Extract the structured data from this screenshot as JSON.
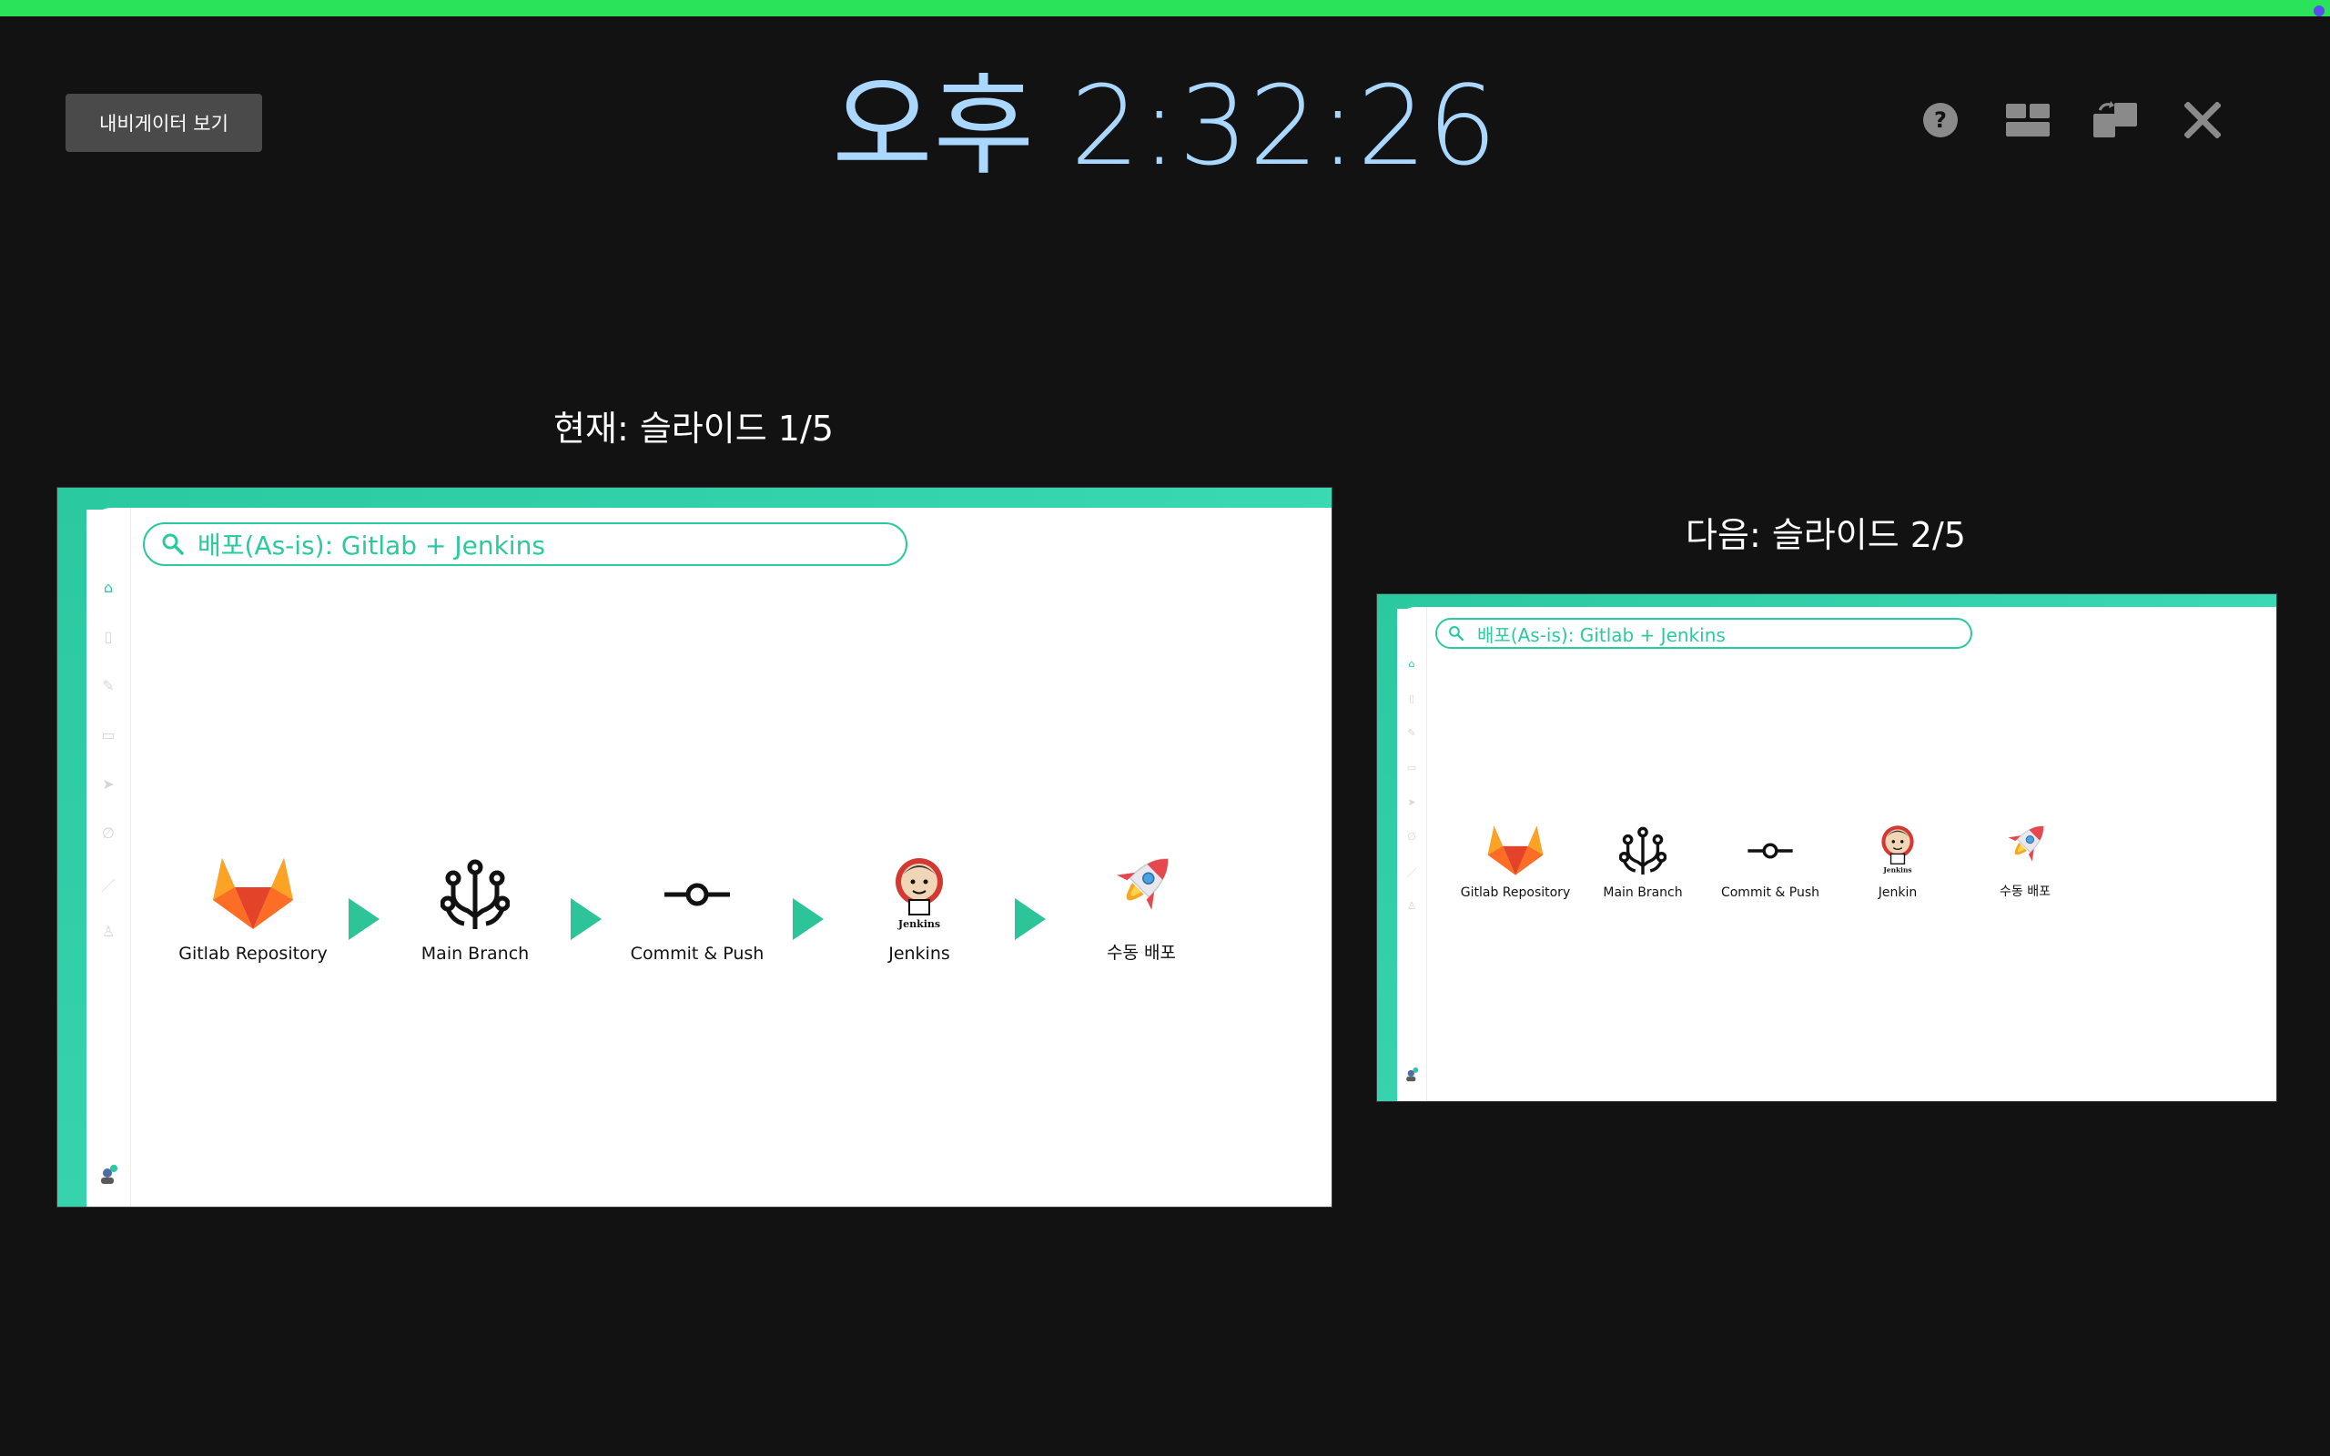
{
  "header": {
    "navigator_button": "내비게이터 보기",
    "clock": "오후 2:32:26",
    "icons": [
      "help-icon",
      "layout-icon",
      "swap-icon",
      "close-icon"
    ]
  },
  "current": {
    "label": "현재: 슬라이드 1/5",
    "search_text": "배포(As-is): Gitlab + Jenkins",
    "steps": [
      {
        "icon": "gitlab-icon",
        "label": "Gitlab Repository"
      },
      {
        "icon": "branch-icon",
        "label": "Main Branch"
      },
      {
        "icon": "commit-icon",
        "label": "Commit & Push"
      },
      {
        "icon": "jenkins-icon",
        "label": "Jenkins"
      },
      {
        "icon": "rocket-icon",
        "label": "수동 배포"
      }
    ]
  },
  "next": {
    "label": "다음: 슬라이드 2/5",
    "search_text": "배포(As-is): Gitlab + Jenkins",
    "steps": [
      {
        "icon": "gitlab-icon",
        "label": "Gitlab Repository"
      },
      {
        "icon": "branch-icon",
        "label": "Main Branch"
      },
      {
        "icon": "commit-icon",
        "label": "Commit & Push"
      },
      {
        "icon": "jenkins-icon",
        "label": "Jenkin"
      },
      {
        "icon": "rocket-icon",
        "label": "수동 배포"
      }
    ]
  },
  "colors": {
    "progress": "#2be35a",
    "accent": "#2ac9a0",
    "clock": "#a9d7ff",
    "background": "#121212"
  }
}
